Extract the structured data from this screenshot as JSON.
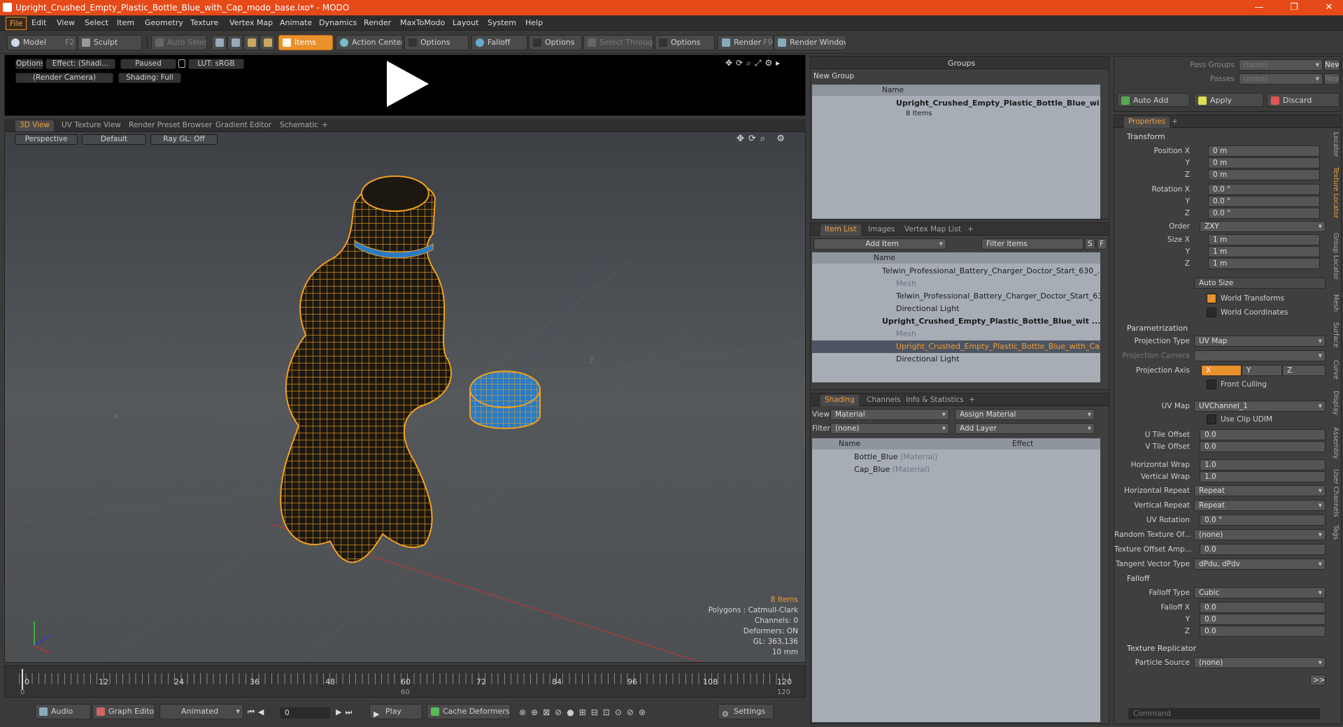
{
  "window": {
    "title": "Upright_Crushed_Empty_Plastic_Bottle_Blue_with_Cap_modo_base.lxo* - MODO",
    "min": "—",
    "max": "❐",
    "close": "✕"
  },
  "menu": [
    "File",
    "Edit",
    "View",
    "Select",
    "Item",
    "Geometry",
    "Texture",
    "Vertex Map",
    "Animate",
    "Dynamics",
    "Render",
    "MaxToModo",
    "Layout",
    "System",
    "Help"
  ],
  "toolbar": {
    "model": "Model",
    "model_key": "F2",
    "sculpt": "Sculpt",
    "auto_select": "Auto Select",
    "items": "Items",
    "action_center": "Action Center",
    "options1": "Options",
    "falloff": "Falloff",
    "options2": "Options",
    "select_through": "Select Through",
    "options3": "Options",
    "render": "Render",
    "render_key": "F9",
    "render_window": "Render Window"
  },
  "preview": {
    "options": "Options",
    "effect": "Effect: (Shadi...",
    "paused": "Paused",
    "lut": "LUT: sRGB",
    "camera": "(Render Camera)",
    "shading": "Shading: Full"
  },
  "viewtabs": [
    "3D View",
    "UV Texture View",
    "Render Preset Browser",
    "Gradient Editor",
    "Schematic",
    "+"
  ],
  "viewport": {
    "perspective": "Perspective",
    "default": "Default",
    "raygl": "Ray GL: Off",
    "axis_x": "X",
    "axis_z": "Z",
    "items": "8 Items",
    "polygons": "Polygons : Catmull-Clark",
    "channels": "Channels: 0",
    "deformers": "Deformers: ON",
    "gl": "GL: 363,136",
    "scale": "10 mm"
  },
  "timeline": {
    "ticks": [
      "0",
      "12",
      "24",
      "36",
      "48",
      "60",
      "72",
      "84",
      "96",
      "108",
      "120"
    ],
    "start": "0",
    "mid": "60",
    "end": "120",
    "end2": "120"
  },
  "bottom": {
    "audio": "Audio",
    "graph_editor": "Graph Editor",
    "animated": "Animated",
    "frame": "0",
    "play": "Play",
    "cache": "Cache Deformers",
    "settings": "Settings"
  },
  "groups": {
    "title": "Groups",
    "new_group": "New Group",
    "col_name": "Name",
    "item_name": "Upright_Crushed_Empty_Plastic_Bottle_Blue_wi...",
    "item_count": "8 Items"
  },
  "itemlist": {
    "tabs": [
      "Item List",
      "Images",
      "Vertex Map List",
      "+"
    ],
    "add_item": "Add Item",
    "filter": "Filter Items",
    "s": "S",
    "f": "F",
    "col_name": "Name",
    "rows": [
      {
        "label": "Telwin_Professional_Battery_Charger_Doctor_Start_630_...",
        "indent": 1,
        "bold": false,
        "dim": false
      },
      {
        "label": "Mesh",
        "indent": 2,
        "bold": false,
        "dim": true
      },
      {
        "label": "Telwin_Professional_Battery_Charger_Doctor_Start_63 ...",
        "indent": 2,
        "bold": false,
        "dim": false
      },
      {
        "label": "Directional Light",
        "indent": 2,
        "bold": false,
        "dim": false
      },
      {
        "label": "Upright_Crushed_Empty_Plastic_Bottle_Blue_wit ...",
        "indent": 1,
        "bold": true,
        "dim": false
      },
      {
        "label": "Mesh",
        "indent": 2,
        "bold": false,
        "dim": true
      },
      {
        "label": "Upright_Crushed_Empty_Plastic_Bottle_Blue_with_Cap",
        "indent": 2,
        "bold": false,
        "dim": false
      },
      {
        "label": "Directional Light",
        "indent": 2,
        "bold": false,
        "dim": false
      }
    ]
  },
  "shading": {
    "tabs": [
      "Shading",
      "Channels",
      "Info & Statistics",
      "+"
    ],
    "view_label": "View",
    "view_value": "Material",
    "assign": "Assign Material",
    "filter_label": "Filter",
    "filter_value": "(none)",
    "add_layer": "Add Layer",
    "col_name": "Name",
    "col_effect": "Effect",
    "rows": [
      {
        "name": "Bottle_Blue",
        "type": "(Material)"
      },
      {
        "name": "Cap_Blue",
        "type": "(Material)"
      }
    ]
  },
  "passes": {
    "pass_groups": "Pass Groups",
    "passes": "Passes",
    "none1": "(none)",
    "none2": "(none)",
    "new1": "New",
    "new2": "New",
    "auto_add": "Auto Add",
    "apply": "Apply",
    "discard": "Discard"
  },
  "properties": {
    "tab": "Properties",
    "plus": "+",
    "transform": "Transform",
    "pos_x": "Position X",
    "pos_y": "Y",
    "pos_z": "Z",
    "pos_vals": [
      "0 m",
      "0 m",
      "0 m"
    ],
    "rot_x": "Rotation X",
    "rot_y": "Y",
    "rot_z": "Z",
    "rot_vals": [
      "0.0 °",
      "0.0 °",
      "0.0 °"
    ],
    "order": "Order",
    "order_val": "ZXY",
    "size_x": "Size X",
    "size_y": "Y",
    "size_z": "Z",
    "size_vals": [
      "1 m",
      "1 m",
      "1 m"
    ],
    "auto_size": "Auto Size",
    "world_transforms": "World Transforms",
    "world_coords": "World Coordinates",
    "param": "Parametrization",
    "proj_type": "Projection Type",
    "proj_type_val": "UV Map",
    "proj_cam": "Projection Camera",
    "proj_cam_val": "...",
    "proj_axis": "Projection Axis",
    "axes": [
      "X",
      "Y",
      "Z"
    ],
    "front_culling": "Front Culling",
    "uv_map": "UV Map",
    "uv_map_val": "UVChannel_1",
    "use_clip": "Use Clip UDIM",
    "u_tile": "U Tile Offset",
    "u_tile_val": "0.0",
    "v_tile": "V Tile Offset",
    "v_tile_val": "0.0",
    "h_wrap": "Horizontal Wrap",
    "h_wrap_val": "1.0",
    "v_wrap": "Vertical Wrap",
    "v_wrap_val": "1.0",
    "h_rep": "Horizontal Repeat",
    "h_rep_val": "Repeat",
    "v_rep": "Vertical Repeat",
    "v_rep_val": "Repeat",
    "uv_rot": "UV Rotation",
    "uv_rot_val": "0.0 °",
    "rand_tex": "Random Texture Of...",
    "rand_tex_val": "(none)",
    "tex_off": "Texture Offset Amp...",
    "tex_off_val": "0.0",
    "tangent": "Tangent Vector Type",
    "tangent_val": "dPdu, dPdv",
    "falloff": "Falloff",
    "falloff_type": "Falloff Type",
    "falloff_type_val": "Cubic",
    "falloff_x": "Falloff X",
    "falloff_y": "Y",
    "falloff_z": "Z",
    "falloff_vals": [
      "0.0",
      "0.0",
      "0.0"
    ],
    "replicator": "Texture Replicator",
    "particle": "Particle Source",
    "particle_val": "(none)",
    "more": ">>"
  },
  "sidetabs": [
    "Locator",
    "Texture Locator",
    "Group Locator",
    "Mesh",
    "Surface",
    "Curve",
    "Display",
    "Assembly",
    "User Channels",
    "Tags"
  ],
  "command": {
    "placeholder": "Command"
  }
}
